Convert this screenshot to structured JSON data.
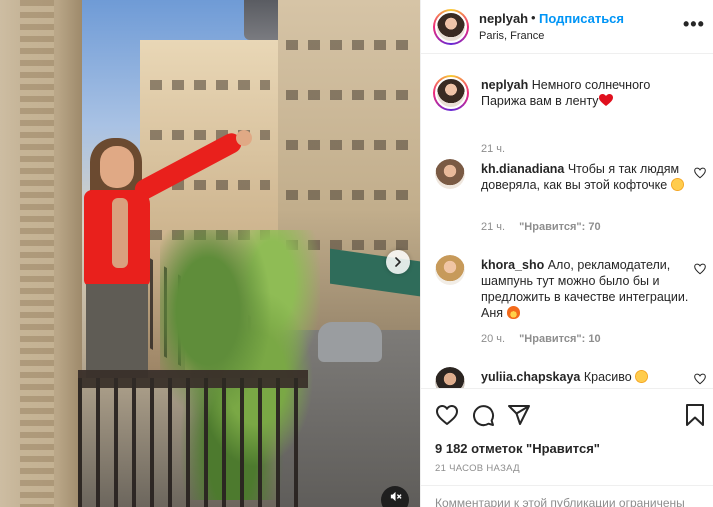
{
  "post": {
    "username": "neplyah",
    "separator": "•",
    "follow_label": "Подписаться",
    "location": "Paris, France",
    "more_label": "•••"
  },
  "caption": {
    "username": "neplyah",
    "text": "Немного солнечного Парижа вам в ленту",
    "emoji": "red-heart",
    "time": "21 ч."
  },
  "comments": [
    {
      "username": "kh.dianadiana",
      "text": "Чтобы я так людям доверяла, как вы этой кофточке",
      "emoji": "heart-eyes-face",
      "time": "21 ч.",
      "likes_label": "\"Нравится\": 70"
    },
    {
      "username": "khora_sho",
      "text": "Ало, рекламодатели, шампунь тут можно было бы и предложить в качестве интеграции. Аня",
      "emoji": "fire",
      "time": "20 ч.",
      "likes_label": "\"Нравится\": 10"
    },
    {
      "username": "yuliia.chapskaya",
      "text": "Красиво",
      "emoji": "heart-eyes-face"
    }
  ],
  "actions": {
    "likes_label": "9 182 отметок \"Нравится\"",
    "post_time": "21 ЧАСОВ НАЗАД",
    "comments_closed": "Комментарии к этой публикации ограничены"
  },
  "icons": {
    "like": "heart-icon",
    "comment": "comment-icon",
    "share": "paper-plane-icon",
    "save": "bookmark-icon",
    "next": "chevron-right-icon",
    "mute": "speaker-muted-icon"
  },
  "colors": {
    "accent": "#0095f6",
    "text": "#262626",
    "secondary": "#8e8e8e",
    "heart_red": "#ed4956"
  }
}
